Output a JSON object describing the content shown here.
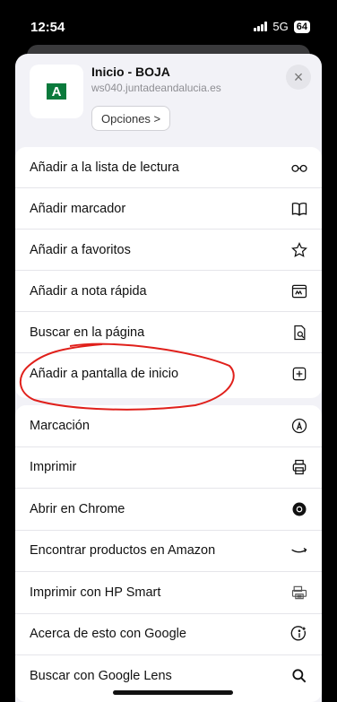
{
  "status": {
    "time": "12:54",
    "network": "5G",
    "battery": "64"
  },
  "header": {
    "site_title": "Inicio - BOJA",
    "site_url": "ws040.juntadeandalucia.es",
    "options_label": "Opciones >",
    "logo_letter": "A"
  },
  "group1": [
    {
      "label": "Añadir a la lista de lectura",
      "icon": "glasses-icon"
    },
    {
      "label": "Añadir marcador",
      "icon": "book-icon"
    },
    {
      "label": "Añadir a favoritos",
      "icon": "star-icon"
    },
    {
      "label": "Añadir a nota rápida",
      "icon": "quick-note-icon"
    },
    {
      "label": "Buscar en la página",
      "icon": "find-in-page-icon"
    },
    {
      "label": "Añadir a pantalla de inicio",
      "icon": "add-square-icon"
    }
  ],
  "group2": [
    {
      "label": "Marcación",
      "icon": "markup-pen-icon"
    },
    {
      "label": "Imprimir",
      "icon": "printer-icon"
    },
    {
      "label": "Abrir en Chrome",
      "icon": "chrome-icon"
    },
    {
      "label": "Encontrar productos en Amazon",
      "icon": "amazon-smile-icon"
    },
    {
      "label": "Imprimir con HP Smart",
      "icon": "hp-printer-icon"
    },
    {
      "label": "Acerca de esto con Google",
      "icon": "google-info-icon"
    },
    {
      "label": "Buscar con Google Lens",
      "icon": "search-icon"
    }
  ],
  "colors": {
    "annotation": "#e0201b",
    "logo_green": "#0a7a3c"
  }
}
